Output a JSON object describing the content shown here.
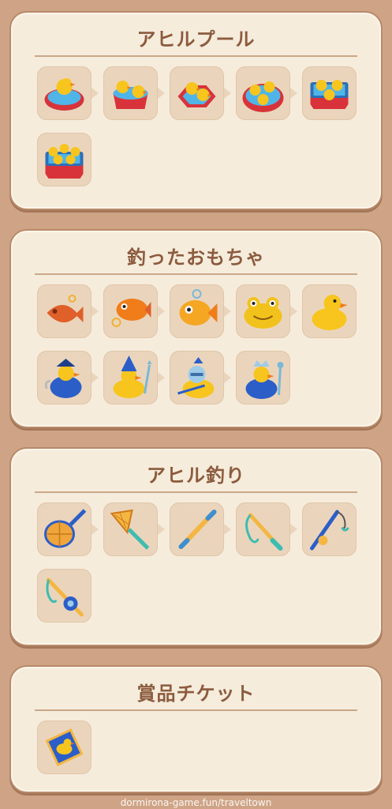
{
  "sections": [
    {
      "title": "アヒルプール",
      "items": [
        {
          "icon": "duck-pool-round-icon"
        },
        {
          "icon": "duck-pool-red-icon"
        },
        {
          "icon": "duck-pool-hexagon-icon"
        },
        {
          "icon": "duck-pool-blue-round-icon"
        },
        {
          "icon": "duck-pool-square-icon"
        },
        {
          "icon": "duck-pool-large-icon"
        }
      ]
    },
    {
      "title": "釣ったおもちゃ",
      "items": [
        {
          "icon": "toy-fish-orange-icon"
        },
        {
          "icon": "toy-fish-keyring-icon"
        },
        {
          "icon": "toy-goldfish-icon"
        },
        {
          "icon": "toy-frog-icon"
        },
        {
          "icon": "rubber-duck-icon"
        },
        {
          "icon": "pirate-duck-icon"
        },
        {
          "icon": "wizard-duck-icon"
        },
        {
          "icon": "knight-duck-icon"
        },
        {
          "icon": "king-duck-icon"
        }
      ]
    },
    {
      "title": "アヒル釣り",
      "items": [
        {
          "icon": "fishing-net-round-icon"
        },
        {
          "icon": "fishing-net-mesh-icon"
        },
        {
          "icon": "stick-icon"
        },
        {
          "icon": "hook-rod-icon"
        },
        {
          "icon": "fishing-rod-icon"
        },
        {
          "icon": "fishing-rod-reel-icon"
        }
      ]
    },
    {
      "title": "賞品チケット",
      "items": [
        {
          "icon": "duck-ticket-icon"
        }
      ]
    }
  ],
  "watermark": "dormirona-game.fun/traveltown"
}
